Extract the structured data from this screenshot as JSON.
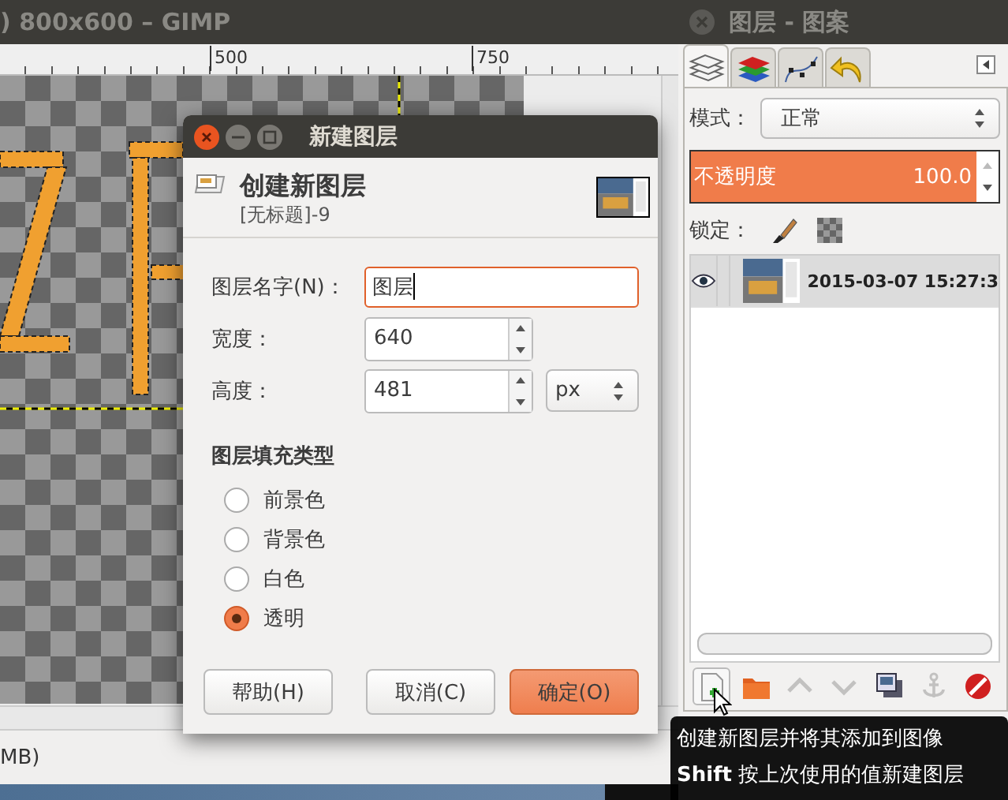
{
  "gimp_window": {
    "title": ") 800x600 – GIMP",
    "ruler_labels": [
      "500",
      "750"
    ],
    "status_text": "MB)"
  },
  "layers_dock": {
    "title": "图层 - 图案",
    "tabs": [
      {
        "kind": "layers",
        "selected": true
      },
      {
        "kind": "channels",
        "selected": false
      },
      {
        "kind": "paths",
        "selected": false
      },
      {
        "kind": "undo",
        "selected": false
      }
    ],
    "mode": {
      "label": "模式：",
      "value": "正常"
    },
    "opacity": {
      "label": "不透明度",
      "reading": "100.0",
      "level": 1.0
    },
    "lock": {
      "label": "锁定："
    },
    "layers": [
      {
        "name": "2015-03-07 15:27:3",
        "visible": true,
        "selected": true
      }
    ],
    "buttons": [
      {
        "kind": "new-layer",
        "disabled": false
      },
      {
        "kind": "folder",
        "disabled": false
      },
      {
        "kind": "raise",
        "disabled": true
      },
      {
        "kind": "lower",
        "disabled": true
      },
      {
        "kind": "duplicate",
        "disabled": false
      },
      {
        "kind": "anchor",
        "disabled": true
      },
      {
        "kind": "delete",
        "disabled": false
      }
    ]
  },
  "tooltip": {
    "lines": [
      "创建新图层并将其添加到图像",
      "**Shift** 按上次使用的值新建图层"
    ]
  },
  "dialog": {
    "title": "新建图层",
    "heading": "创建新图层",
    "subtitle": "[无标题]-9",
    "fields": [
      {
        "label": "图层名字(N)：",
        "value": "图层",
        "kind": "text",
        "focused": true
      },
      {
        "label": "宽度：",
        "value": "640",
        "kind": "spin",
        "focused": false
      },
      {
        "label": "高度：",
        "value": "481",
        "kind": "spin",
        "unit": "px",
        "focused": false
      }
    ],
    "fill_title": "图层填充类型",
    "fill_options": [
      {
        "label": "前景色",
        "selected": false
      },
      {
        "label": "背景色",
        "selected": false
      },
      {
        "label": "白色",
        "selected": false
      },
      {
        "label": "透明",
        "selected": true
      }
    ],
    "buttons": [
      {
        "label": "帮助(H)",
        "kind": "normal"
      },
      {
        "label": "取消(C)",
        "kind": "normal"
      },
      {
        "label": "确定(O)",
        "kind": "default"
      }
    ]
  }
}
